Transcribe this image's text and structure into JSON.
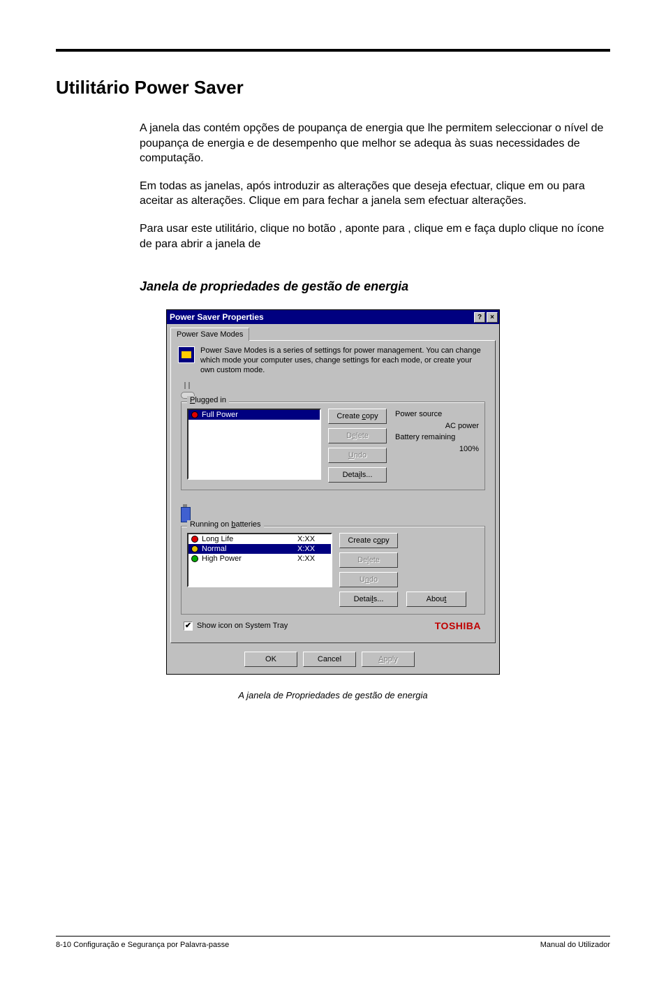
{
  "doc": {
    "heading": "Utilitário Power Saver",
    "p1": "A janela das                                                                                       contém opções de poupança de energia que lhe permitem seleccionar o nível de poupança de energia e de desempenho que melhor se adequa às suas necessidades de computação.",
    "p2": "Em todas as janelas, após introduzir as alterações que deseja efectuar, clique em         ou                para aceitar as alterações. Clique em                   para fechar a janela sem efectuar alterações.",
    "p3": "Para usar este utilitário, clique no botão               , aponte para                      , clique em                                             e faça duplo clique no ícone de                           para abrir a janela de",
    "subheading": "Janela de propriedades de gestão de energia",
    "caption": "A janela de Propriedades de gestão de energia"
  },
  "dialog": {
    "title": "Power Saver Properties",
    "help_btn": "?",
    "close_btn": "×",
    "tab_label": "Power Save Modes",
    "intro": "Power Save Modes is a series of settings for power management. You can change which mode your computer uses, change settings for each mode, or create your own custom mode.",
    "group1": {
      "legend_pre": "P",
      "legend_rest": "lugged in",
      "list": {
        "item0": "Full Power"
      },
      "buttons": {
        "create_pre": "Create ",
        "create_u": "c",
        "create_post": "opy",
        "delete_pre": "D",
        "delete_u": "e",
        "delete_post": "lete",
        "undo_pre": "",
        "undo_u": "U",
        "undo_post": "ndo",
        "details_pre": "Deta",
        "details_u": "i",
        "details_post": "ls..."
      },
      "side": {
        "src_label": "Power source",
        "src_value": "AC power",
        "bat_label": "Battery remaining",
        "bat_value": "100%"
      }
    },
    "group2": {
      "legend_pre": "Running on ",
      "legend_u": "b",
      "legend_post": "atteries",
      "items": {
        "i0": {
          "name": "Long Life",
          "time": "X:XX"
        },
        "i1": {
          "name": "Normal",
          "time": "X:XX"
        },
        "i2": {
          "name": "High Power",
          "time": "X:XX"
        }
      },
      "buttons": {
        "create_pre": "Create c",
        "create_u": "o",
        "create_post": "py",
        "delete_pre": "De",
        "delete_u": "l",
        "delete_post": "ete",
        "undo_pre": "U",
        "undo_u": "n",
        "undo_post": "do",
        "details_pre": "Detai",
        "details_u": "l",
        "details_post": "s..."
      },
      "about_pre": "Abou",
      "about_u": "t",
      "about_post": ""
    },
    "checkbox": {
      "mark": "✔",
      "pre": "",
      "u": "S",
      "post": "how icon on System Tray"
    },
    "brand": "TOSHIBA",
    "bottom": {
      "ok": "OK",
      "cancel": "Cancel",
      "apply_pre": "",
      "apply_u": "A",
      "apply_post": "pply"
    }
  },
  "footer": {
    "left": "8-10  Configuração e Segurança por Palavra-passe",
    "right": "Manual do Utilizador"
  }
}
